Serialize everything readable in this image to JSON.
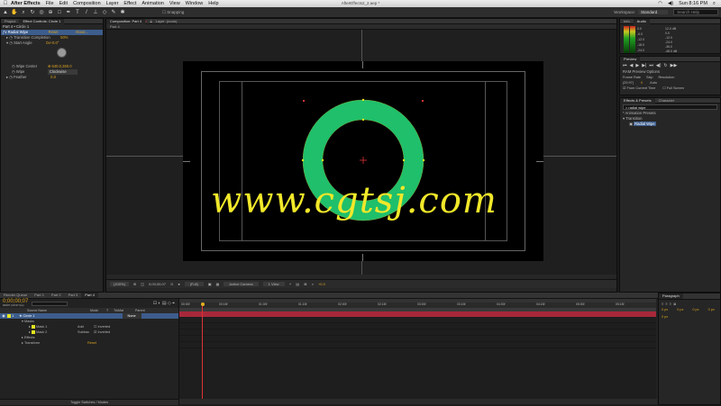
{
  "menubar": {
    "apple": "",
    "app": "After Effects",
    "items": [
      "File",
      "Edit",
      "Composition",
      "Layer",
      "Effect",
      "Animation",
      "View",
      "Window",
      "Help"
    ],
    "clock": "Sun 8:16 PM"
  },
  "document_title": "AfterEffects2_2.aep *",
  "toolbar": {
    "snapping": "Snapping",
    "workspace_label": "Workspace:",
    "workspace_value": "Standard",
    "search_help": "Search Help"
  },
  "project_panel": {
    "tabs": [
      "Project",
      "Effect Controls: Circle 1"
    ],
    "subject": "Part 4 • Circle 1",
    "effect_name": "Radial Wipe",
    "reset": "Reset",
    "about": "About...",
    "properties": [
      {
        "name": "Transition Completion",
        "value": "50%"
      },
      {
        "name": "Start Angle",
        "value": "0x+0.0°"
      },
      {
        "name": "Wipe Center",
        "value": "640.0,360.0"
      },
      {
        "name": "Wipe",
        "value": "Clockwise"
      },
      {
        "name": "Feather",
        "value": "0.0"
      }
    ]
  },
  "composition_panel": {
    "tabs": [
      "Composition: Part 4",
      "Layer: (none)"
    ],
    "subtab": "Part 4",
    "footer": {
      "zoom": "(100%)",
      "timecode": "0;00;00;07",
      "resolution": "(Full)",
      "camera": "Active Camera",
      "view": "1 View",
      "exposure": "+0.0"
    }
  },
  "info_panel": {
    "tabs": [
      "Info",
      "Audio"
    ],
    "levels": [
      "0.0",
      "-6.0",
      "-12.0",
      "-18.0",
      "-24.0"
    ],
    "db_values": [
      "12.0 dB",
      "0.0",
      "-12.0",
      "-24.0",
      "-36.0",
      "-48.0 dB"
    ]
  },
  "preview_panel": {
    "title": "Preview",
    "ram_options": "RAM Preview Options",
    "labels": [
      "Frame Rate",
      "Skip",
      "Resolution"
    ],
    "values": [
      "(29.97)",
      "0",
      "Auto"
    ],
    "from_current": "From Current Time",
    "full_screen": "Full Screen"
  },
  "effects_panel": {
    "tabs": [
      "Effects & Presets",
      "Character"
    ],
    "search": "radial wipe",
    "items": [
      "* Animation Presets",
      "Transition",
      "Radial Wipe"
    ]
  },
  "timeline": {
    "tabs": [
      "Render Queue",
      "Part 1",
      "Part 2",
      "Part 3",
      "Part 4"
    ],
    "timecode": "0;00;00;07",
    "fps": "00007 (29.97 fps)",
    "search_placeholder": "",
    "columns": [
      "Source Name",
      "Mode",
      "T",
      "TrkMat",
      "Parent"
    ],
    "layers": [
      {
        "num": "1",
        "name": "Circle 1",
        "parent": "None"
      },
      {
        "name": "Masks"
      },
      {
        "name": "Mask 1",
        "mode": "Add",
        "inverted": "Inverted"
      },
      {
        "name": "Mask 2",
        "mode": "Subtrac",
        "inverted": "Inverted"
      },
      {
        "name": "Effects"
      },
      {
        "name": "Transform",
        "value": "Reset"
      }
    ],
    "ruler": [
      "00:00f",
      "00:15f",
      "01:00f",
      "01:15f",
      "02:00f",
      "02:15f",
      "03:00f",
      "03:15f",
      "04:00f",
      "04:15f",
      "05:00f",
      "05:15f"
    ],
    "footer": "Toggle Switches / Modes"
  },
  "paragraph_panel": {
    "title": "Paragraph",
    "values": [
      "0 px",
      "0 px",
      "0 px",
      "0 px",
      "0 px"
    ]
  },
  "watermark": "www.cgtsj.com",
  "colors": {
    "ring": "#1fbf6b",
    "watermark": "#f1e82a",
    "accent": "#d9a21f"
  }
}
